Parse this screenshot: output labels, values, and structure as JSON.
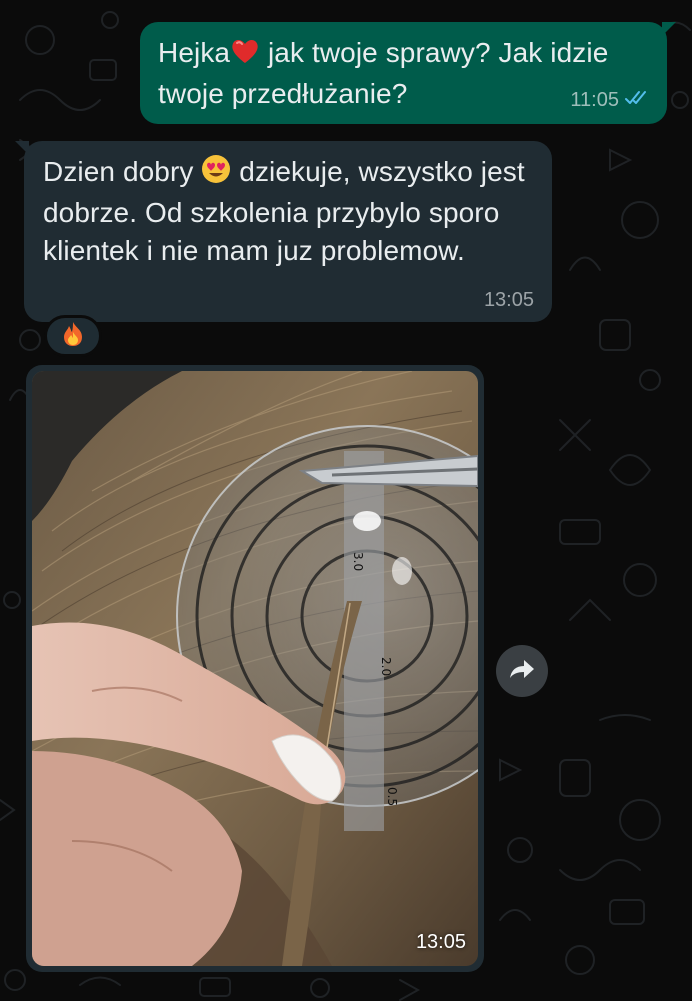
{
  "colors": {
    "outgoing_bubble": "#005c4b",
    "incoming_bubble": "#202c33",
    "background": "#0b0b0b",
    "read_ticks": "#53bdeb"
  },
  "messages": [
    {
      "direction": "outgoing",
      "text_part1": "Hejka",
      "emoji": "red-heart",
      "text_part2": " jak twoje sprawy? Jak idzie twoje przedłużanie?",
      "time": "11:05",
      "status_icon": "double-check-read-icon"
    },
    {
      "direction": "incoming",
      "text_part1": "Dzien dobry ",
      "emoji": "heart-eyes-face",
      "text_part2": " dziekuje, wszystko jest dobrze. Od szkolenia przybylo sporo klientek i nie mam juz problemow.",
      "time": "13:05",
      "reaction": "fire-emoji"
    },
    {
      "direction": "incoming",
      "type": "image",
      "image_description_icon": "hair-extension-photo",
      "time": "13:05"
    }
  ],
  "actions": {
    "forward_icon": "forward-arrow-icon"
  }
}
